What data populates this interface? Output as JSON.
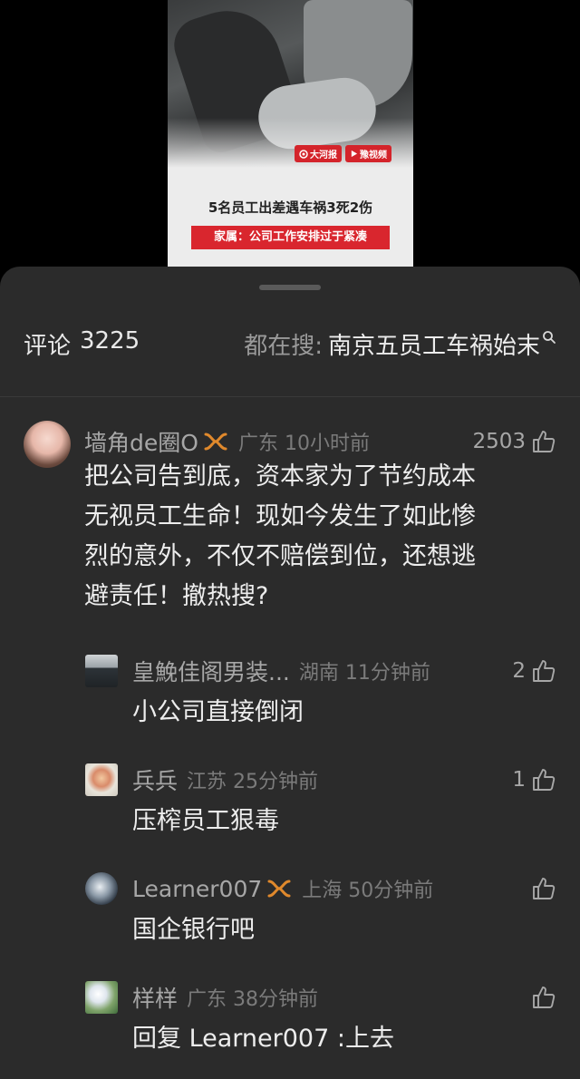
{
  "video": {
    "logo_primary": "大河报",
    "logo_secondary": "豫视频",
    "caption_title": "5名员工出差遇车祸3死2伤",
    "caption_sub": "家属：公司工作安排过于紧凑"
  },
  "header": {
    "comments_label": "评论",
    "comments_count": "3225",
    "hot_search_label": "都在搜:",
    "hot_search_term": "南京五员工车祸始末"
  },
  "comments": [
    {
      "username": "墙角de圈O",
      "location": "广东",
      "time": "10小时前",
      "likes": "2503",
      "text_lines": [
        "把公司告到底，资本家为了节约成本",
        "无视员工生命！现如今发生了如此惨",
        "烈的意外，不仅不赔偿到位，还想逃",
        "避责任！撤热搜?"
      ]
    }
  ],
  "replies": [
    {
      "username": "皇鮸佳阁男装...",
      "location": "湖南",
      "time": "11分钟前",
      "likes": "2",
      "text": "小公司直接倒闭"
    },
    {
      "username": "兵兵",
      "location": "江苏",
      "time": "25分钟前",
      "likes": "1",
      "text": "压榨员工狠毒"
    },
    {
      "username": "Learner007",
      "location": "上海",
      "time": "50分钟前",
      "likes": "",
      "text": "国企银行吧"
    },
    {
      "username": "样样",
      "location": "广东",
      "time": "38分钟前",
      "likes": "",
      "text": "回复 Learner007 :上去"
    }
  ],
  "colors": {
    "sheet_bg": "#2b2b2b",
    "vip_badge": "#e0892c",
    "caption_red": "#d9262e"
  }
}
